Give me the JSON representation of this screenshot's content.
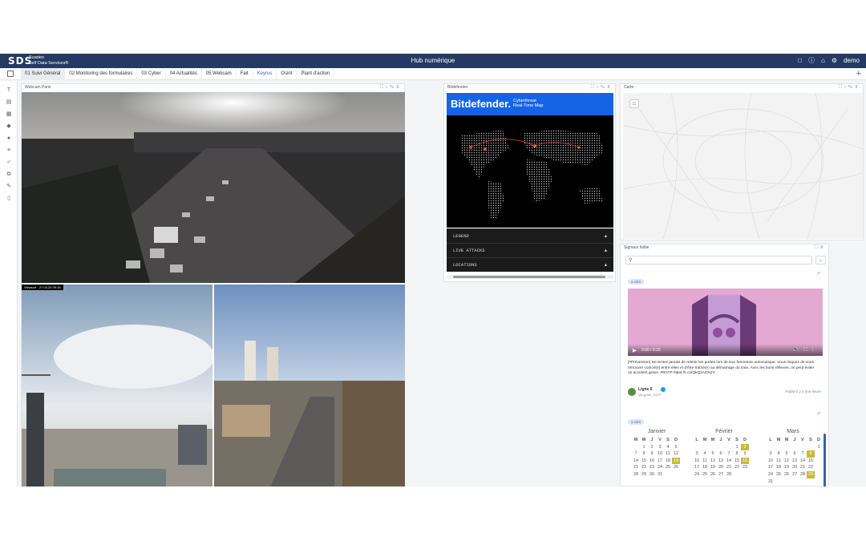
{
  "header": {
    "logo": "SDS",
    "logo_line1": "Suadeo",
    "logo_line2": "Self Data Services®",
    "title": "Hub numérique",
    "user": "demo"
  },
  "tabs": [
    {
      "label": "01 Suivi Général",
      "active": true
    },
    {
      "label": "02 Monitoring des formulaires"
    },
    {
      "label": "03 Cyber"
    },
    {
      "label": "04 Actualités"
    },
    {
      "label": "05 Webcam"
    },
    {
      "label": "Fait"
    },
    {
      "label": "Keyrus",
      "keyword": true
    },
    {
      "label": "Osint"
    },
    {
      "label": "Plant d'action"
    }
  ],
  "widgets": {
    "webcam": {
      "title": "Webcam Paris",
      "overlay": "Viewsurf · 27.03.24 09:15"
    },
    "bitdefender": {
      "title": "Bitdefender",
      "brand": "Bitdefender.",
      "sub_line1": "Cyberthreat",
      "sub_line2": "Real-Time Map",
      "rows": [
        "LEGEND",
        "LIVE ATTACKS",
        "LOCATIONS"
      ]
    },
    "carte": {
      "title": "Carte"
    },
    "signaux": {
      "title": "Signaux faible",
      "badge1": "x.com",
      "video_time": "0:00 / 0:15",
      "tweet_line1": "[#Prévention] Ne tentez jamais de retenir les portes lors de leur fermeture automatique. Vous risquez de vous",
      "tweet_line2": "retrouver coincé(e) entre elles et d'être traîné(e) au démarrage du train. Avec les bons réflexes, on peut éviter",
      "tweet_line3": "un accident grave. #RATP https://t.co/QkQzAZXi2Y",
      "author_name": "Ligne 6",
      "author_handle": "@Ligne6_RATP",
      "published": "Publié il y a une heure",
      "badge2": "x.com"
    }
  },
  "calendar": {
    "day_headers": [
      "M",
      "M",
      "J",
      "V",
      "S",
      "D"
    ],
    "day_headers_lmm": [
      "L",
      "M",
      "M",
      "J",
      "V",
      "S",
      "D"
    ],
    "months": [
      {
        "name": "Janvier",
        "rows": [
          [
            "",
            "1",
            "2",
            "3",
            "4",
            "5"
          ],
          [
            "7",
            "8",
            "9",
            "10",
            "11",
            "12"
          ],
          [
            "14",
            "15",
            "16",
            "17",
            "18",
            "19"
          ],
          [
            "21",
            "22",
            "23",
            "24",
            "25",
            "26"
          ],
          [
            "28",
            "29",
            "30",
            "31",
            "",
            ""
          ]
        ],
        "hl": [
          "19"
        ]
      },
      {
        "name": "Février",
        "rows": [
          [
            "",
            "",
            "",
            "",
            "",
            "1",
            "2"
          ],
          [
            "3",
            "4",
            "5",
            "6",
            "7",
            "8",
            "9"
          ],
          [
            "10",
            "11",
            "12",
            "13",
            "14",
            "15",
            "16"
          ],
          [
            "17",
            "18",
            "19",
            "20",
            "21",
            "22",
            "23"
          ],
          [
            "24",
            "25",
            "26",
            "27",
            "28",
            "",
            ""
          ]
        ],
        "hl": [
          "2",
          "16"
        ]
      },
      {
        "name": "Mars",
        "rows": [
          [
            "",
            "",
            "",
            "",
            "",
            "",
            "1"
          ],
          [
            "3",
            "4",
            "5",
            "6",
            "7",
            "8",
            ""
          ],
          [
            "10",
            "11",
            "12",
            "13",
            "14",
            "15",
            ""
          ],
          [
            "17",
            "18",
            "19",
            "20",
            "21",
            "22",
            ""
          ],
          [
            "24",
            "25",
            "26",
            "27",
            "28",
            "29",
            ""
          ],
          [
            "31",
            "",
            "",
            "",
            "",
            "",
            ""
          ]
        ],
        "hl": [
          "8",
          "29"
        ]
      }
    ]
  },
  "colors": {
    "topbar": "#243a63",
    "accent": "#3d5fb0",
    "bitdefender": "#1464e6",
    "highlight": "#c9b93c"
  }
}
